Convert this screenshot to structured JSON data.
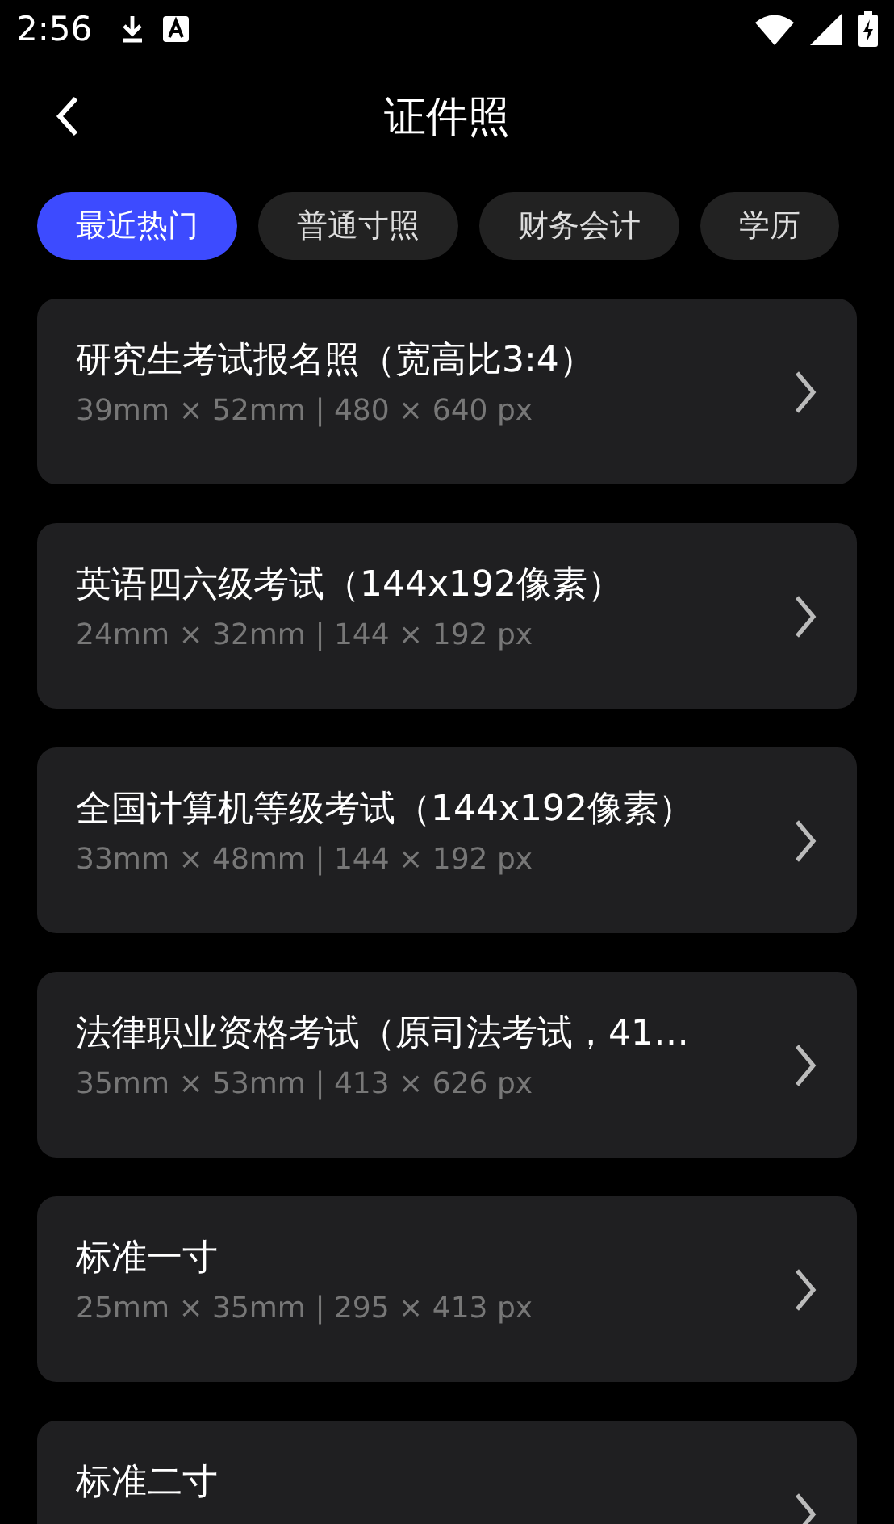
{
  "status_bar": {
    "time": "2:56"
  },
  "header": {
    "title": "证件照"
  },
  "tabs": [
    {
      "label": "最近热门",
      "selected": true
    },
    {
      "label": "普通寸照",
      "selected": false
    },
    {
      "label": "财务会计",
      "selected": false
    },
    {
      "label": "学历",
      "selected": false
    }
  ],
  "items": [
    {
      "title": "研究生考试报名照（宽高比3:4）",
      "size": "39mm × 52mm | 480 × 640 px"
    },
    {
      "title": "英语四六级考试（144x192像素）",
      "size": "24mm × 32mm | 144 × 192 px"
    },
    {
      "title": "全国计算机等级考试（144x192像素）",
      "size": "33mm × 48mm | 144 × 192 px"
    },
    {
      "title": "法律职业资格考试（原司法考试，41…",
      "size": "35mm × 53mm | 413 × 626 px"
    },
    {
      "title": "标准一寸",
      "size": "25mm × 35mm | 295 × 413 px"
    },
    {
      "title": "标准二寸"
    }
  ]
}
